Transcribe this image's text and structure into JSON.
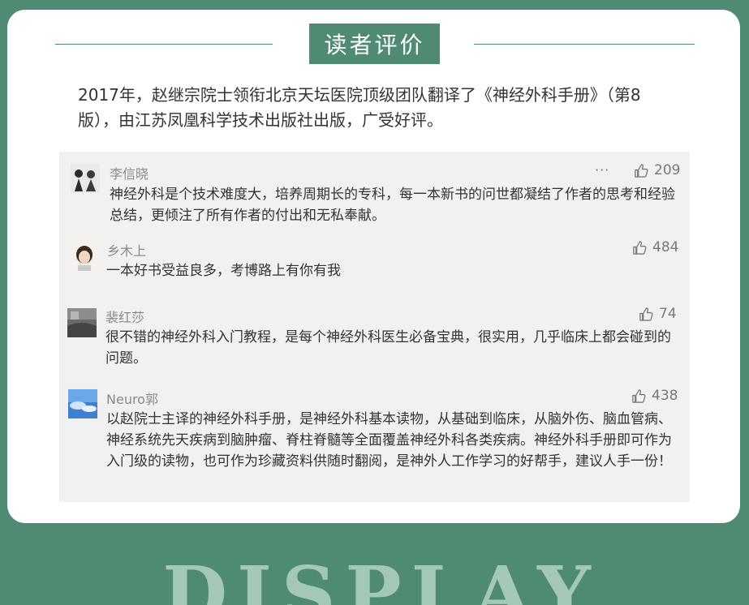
{
  "section_title": "读者评价",
  "intro": "2017年，赵继宗院士领衔北京天坛医院顶级团队翻译了《神经外科手册》（第8版），由江苏凤凰科学技术出版社出版，广受好评。",
  "more_label": "···",
  "comments": [
    {
      "user": "李信晓",
      "likes": "209",
      "text": "神经外科是个技术难度大，培养周期长的专科，每一本新书的问世都凝结了作者的思考和经验总结，更倾注了所有作者的付出和无私奉献。"
    },
    {
      "user": "乡木上",
      "likes": "484",
      "text": "一本好书受益良多，考博路上有你有我"
    },
    {
      "user": "裴红莎",
      "likes": "74",
      "text": "很不错的神经外科入门教程，是每个神经外科医生必备宝典，很实用，几乎临床上都会碰到的问题。"
    },
    {
      "user": "Neuro郭",
      "likes": "438",
      "text": "以赵院士主译的神经外科手册，是神经外科基本读物，从基础到临床，从脑外伤、脑血管病、神经系统先天疾病到脑肿瘤、脊柱脊髓等全面覆盖神经外科各类疾病。神经外科手册即可作为入门级的读物，也可作为珍藏资料供随时翻阅，是神外人工作学习的好帮手，建议人手一份！"
    }
  ],
  "footer_word": "DISPLAY",
  "colors": {
    "brand_green": "#4f8b72",
    "card": "#ffffff",
    "comment_bg": "#f1f1f1"
  },
  "icons": {
    "like": "thumbs-up-icon",
    "more": "more-icon"
  }
}
